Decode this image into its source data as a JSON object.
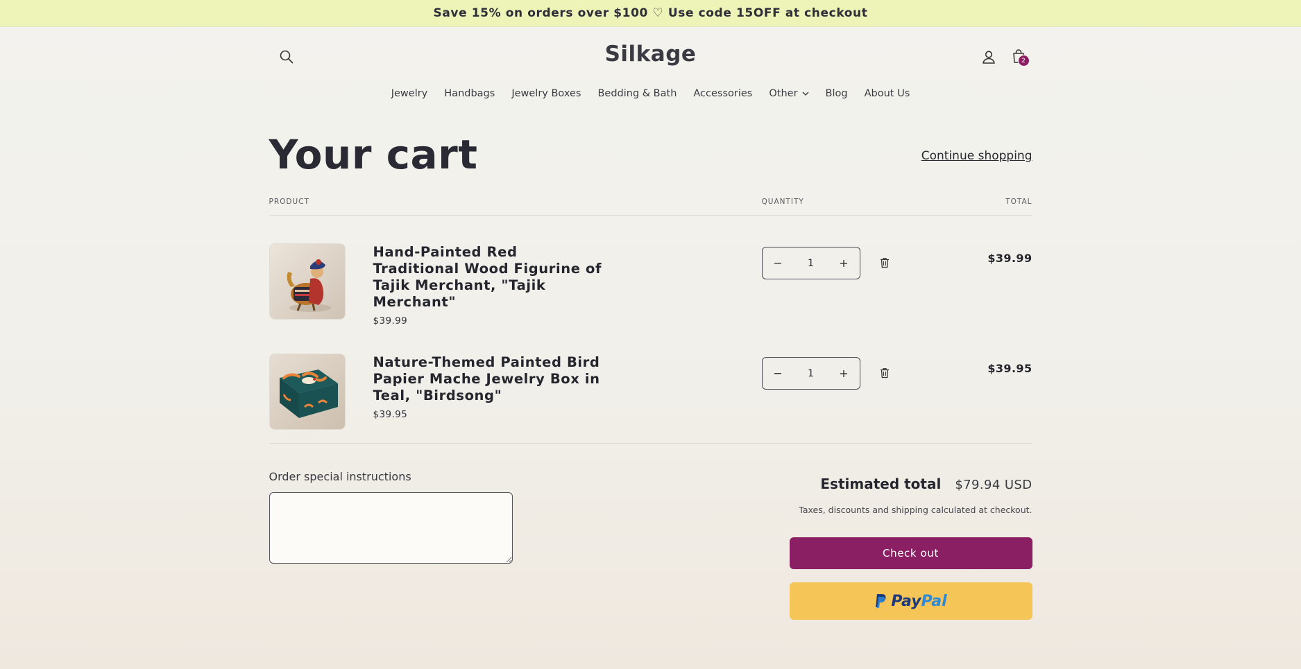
{
  "announcement": "Save 15% on orders over $100 ♡ Use code 15OFF at checkout",
  "header": {
    "logo": "Silkage",
    "cart_count": "2",
    "icons": [
      "search-icon",
      "account-icon",
      "cart-icon"
    ]
  },
  "nav": {
    "items": [
      {
        "label": "Jewelry"
      },
      {
        "label": "Handbags"
      },
      {
        "label": "Jewelry Boxes"
      },
      {
        "label": "Bedding & Bath"
      },
      {
        "label": "Accessories"
      },
      {
        "label": "Other"
      },
      {
        "label": "Blog"
      },
      {
        "label": "About Us"
      }
    ]
  },
  "cart": {
    "title": "Your cart",
    "continue_label": "Continue shopping",
    "columns": {
      "product": "PRODUCT",
      "quantity": "QUANTITY",
      "total": "TOTAL"
    },
    "items": [
      {
        "name": "Hand-Painted Red Traditional Wood Figurine of Tajik Merchant, \"Tajik Merchant\"",
        "price": "$39.99",
        "quantity": "1",
        "line_total": "$39.99"
      },
      {
        "name": "Nature-Themed Painted Bird Papier Mache Jewelry Box in Teal, \"Birdsong\"",
        "price": "$39.95",
        "quantity": "1",
        "line_total": "$39.95"
      }
    ],
    "instructions_label": "Order special instructions",
    "instructions_value": "",
    "estimated_total_label": "Estimated total",
    "estimated_total_value": "$79.94 USD",
    "tax_note": "Taxes, discounts and shipping calculated at checkout.",
    "checkout_label": "Check out",
    "paypal_pay": "Pay",
    "paypal_pal": "Pal"
  },
  "colors": {
    "announcement_bg": "#eef3b8",
    "accent": "#8b1f63",
    "paypal_bg": "#f6c557"
  }
}
